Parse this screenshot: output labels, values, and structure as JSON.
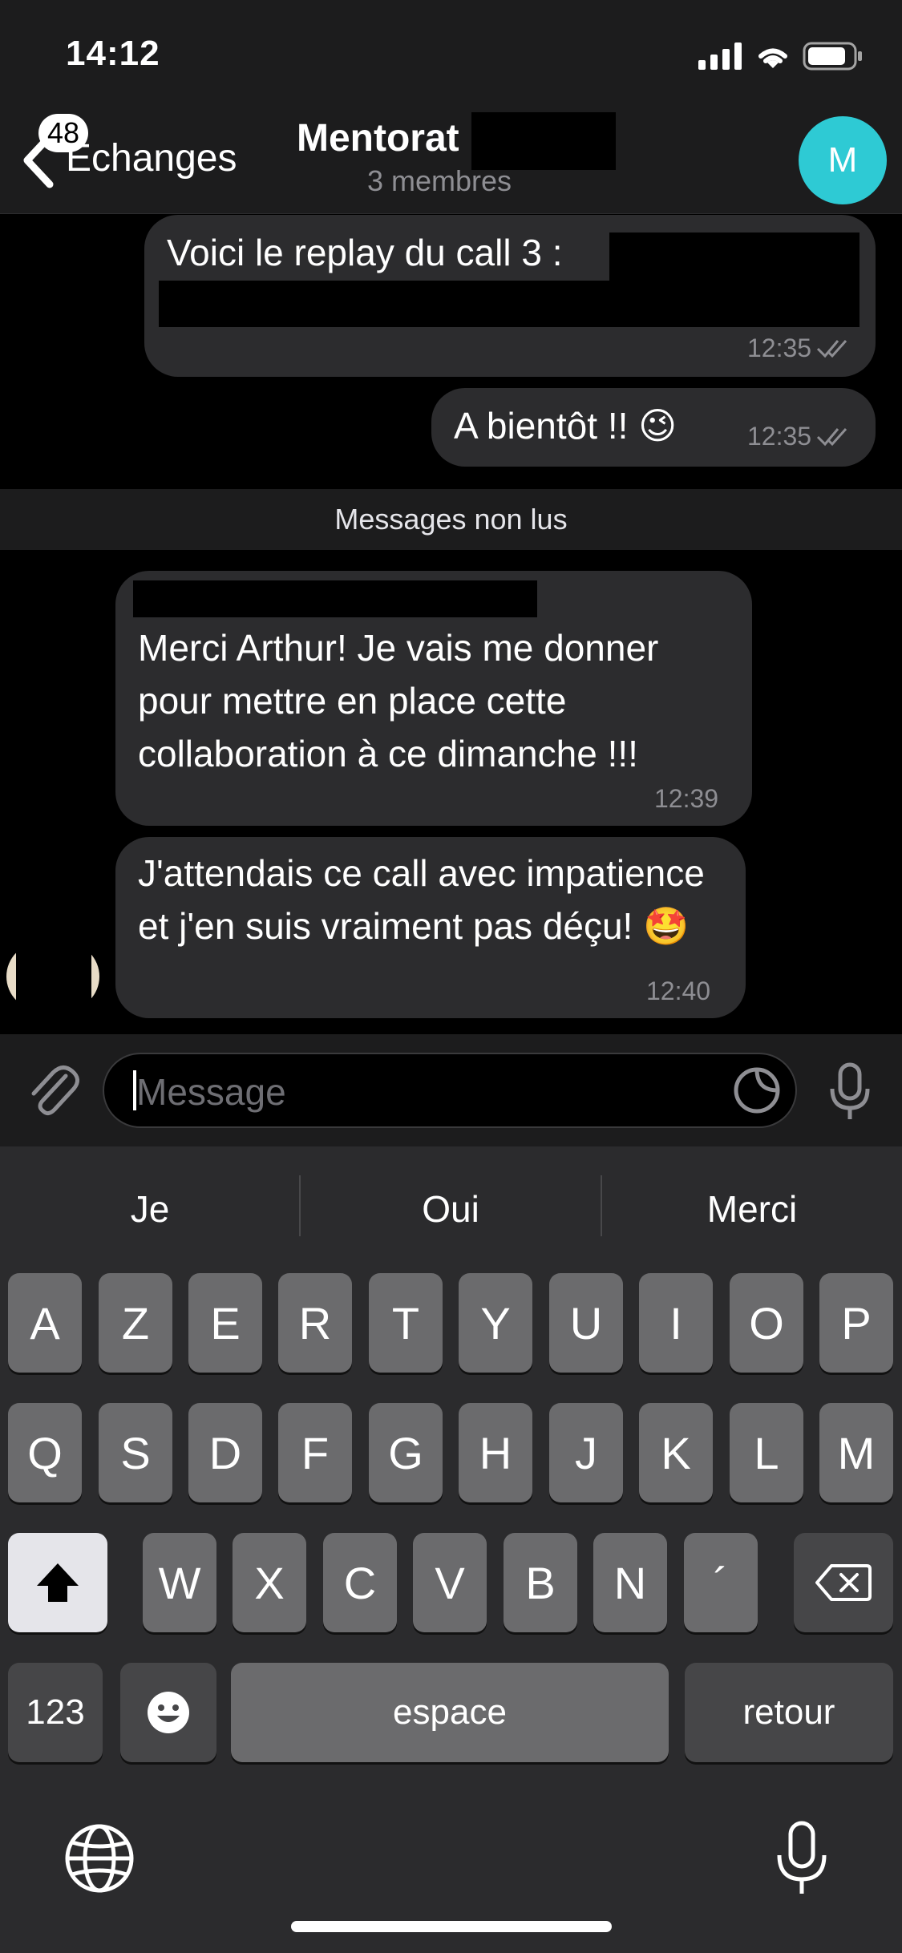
{
  "status_bar": {
    "time": "14:12"
  },
  "header": {
    "back_badge": "48",
    "back_label": "Échanges",
    "title": "Mentorat",
    "subtitle": "3 membres",
    "avatar_initial": "M",
    "avatar_color": "#2ecad4"
  },
  "messages": [
    {
      "text": "Voici le replay du call 3 :",
      "time": "12:35",
      "read": true
    },
    {
      "text": "A bientôt !! 😉",
      "time": "12:35",
      "read": true
    },
    {
      "text": "Merci Arthur! Je vais me donner pour mettre en place cette collaboration à ce dimanche !!!",
      "time": "12:39"
    },
    {
      "text": "J'attendais ce call avec impatience et j'en suis vraiment pas déçu! 🤩",
      "time": "12:40"
    }
  ],
  "unread_label": "Messages non lus",
  "input": {
    "placeholder": "Message"
  },
  "keyboard": {
    "suggestions": [
      "Je",
      "Oui",
      "Merci"
    ],
    "row1": [
      "A",
      "Z",
      "E",
      "R",
      "T",
      "Y",
      "U",
      "I",
      "O",
      "P"
    ],
    "row2": [
      "Q",
      "S",
      "D",
      "F",
      "G",
      "H",
      "J",
      "K",
      "L",
      "M"
    ],
    "row3": [
      "W",
      "X",
      "C",
      "V",
      "B",
      "N",
      "´"
    ],
    "numbers_key": "123",
    "space_key": "espace",
    "return_key": "retour"
  }
}
